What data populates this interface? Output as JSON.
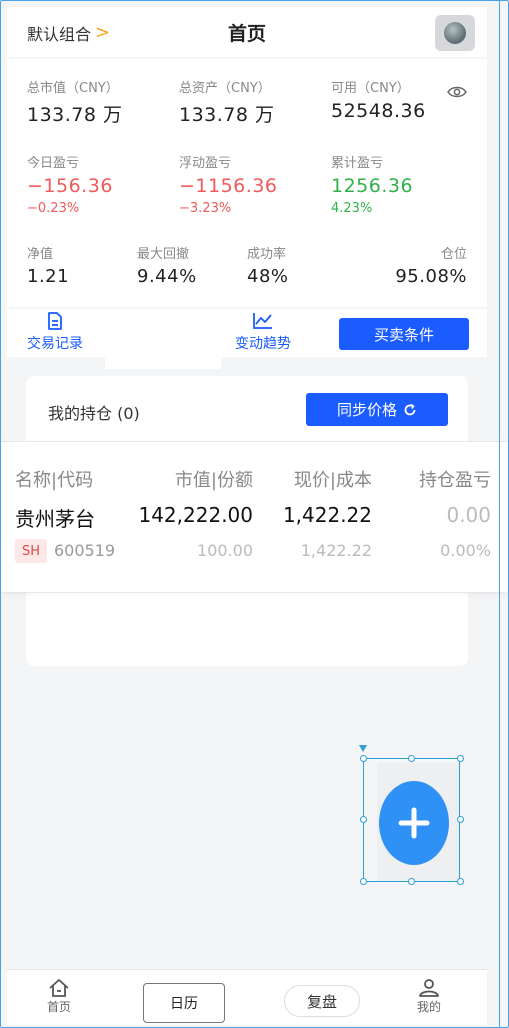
{
  "header": {
    "portfolio_label": "默认组合",
    "portfolio_chevron": ">",
    "title": "首页"
  },
  "stats": {
    "total_market_value": {
      "label": "总市值（CNY）",
      "value": "133.78 万"
    },
    "total_assets": {
      "label": "总资产（CNY）",
      "value": "133.78 万"
    },
    "available": {
      "label": "可用（CNY）",
      "value": "52548.36"
    },
    "today_pnl": {
      "label": "今日盈亏",
      "value": "−156.36",
      "pct": "−0.23%"
    },
    "floating_pnl": {
      "label": "浮动盈亏",
      "value": "−1156.36",
      "pct": "−3.23%"
    },
    "cumulative_pnl": {
      "label": "累计盈亏",
      "value": "1256.36",
      "pct": "4.23%"
    },
    "nav": {
      "label": "净值",
      "value": "1.21"
    },
    "max_drawdown": {
      "label": "最大回撤",
      "value": "9.44%"
    },
    "win_rate": {
      "label": "成功率",
      "value": "48%"
    },
    "position": {
      "label": "仓位",
      "value": "95.08%"
    }
  },
  "actions": {
    "trade_records": "交易记录",
    "change_trend": "变动趋势",
    "trade_conditions": "买卖条件"
  },
  "holdings": {
    "title": "我的持仓 (0)",
    "sync_button": "同步价格",
    "columns": [
      "名称|代码",
      "市值|份额",
      "现价|成本",
      "持仓盈亏"
    ],
    "rows": [
      {
        "name": "贵州茅台",
        "exchange": "SH",
        "code": "600519",
        "market_value": "142,222.00",
        "shares": "100.00",
        "price": "1,422.22",
        "cost": "1,422.22",
        "pnl": "0.00",
        "pnl_pct": "0.00%"
      }
    ]
  },
  "bottom_nav": {
    "home": "首页",
    "calendar": "日历",
    "review": "复盘",
    "mine": "我的"
  },
  "colors": {
    "accent": "#1a5cff",
    "loss": "#f05a5a",
    "gain": "#2fb24a",
    "fab": "#2f90f5"
  }
}
